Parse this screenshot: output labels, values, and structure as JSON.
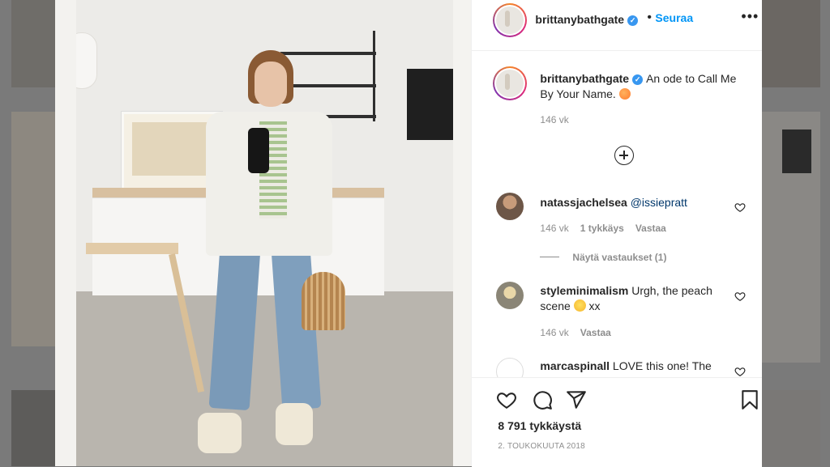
{
  "post": {
    "username": "brittanybathgate",
    "follow_label": "Seuraa",
    "separator": "•",
    "more_label": "•••"
  },
  "caption": {
    "username": "brittanybathgate",
    "text": "An ode to Call Me By Your Name.",
    "time": "146 vk"
  },
  "comments": [
    {
      "username": "natassjachelsea",
      "text": "@issiepratt",
      "time": "146 vk",
      "likes": "1 tykkäys",
      "reply": "Vastaa",
      "view_replies": "Näytä vastaukset (1)"
    },
    {
      "username": "styleminimalism",
      "text": "Urgh, the peach scene",
      "suffix": "xx",
      "time": "146 vk",
      "reply": "Vastaa"
    },
    {
      "username": "marcaspinall",
      "text": "LOVE this one! The"
    }
  ],
  "footer": {
    "likes": "8 791 tykkäystä",
    "date": "2. TOUKOKUUTA 2018"
  },
  "icons": {
    "heart": "heart-icon",
    "comment": "comment-icon",
    "share": "paper-plane-icon",
    "save": "bookmark-icon",
    "add_comment": "plus-circle-icon",
    "verified": "verified-badge-icon"
  },
  "colors": {
    "follow": "#0095f6",
    "verified": "#3897f0",
    "text": "#262626",
    "muted": "#8e8e8e"
  }
}
